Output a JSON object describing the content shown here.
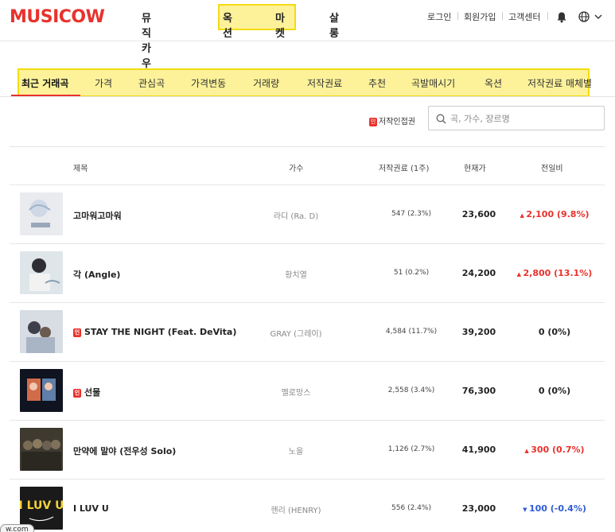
{
  "header": {
    "logo": "MUSICOW",
    "nav": [
      "뮤직카우란",
      "옥션",
      "마켓",
      "살롱"
    ],
    "util": [
      "로그인",
      "회원가입",
      "고객센터"
    ],
    "icons": [
      "bell-icon",
      "globe-icon",
      "chevron-down-icon"
    ]
  },
  "tabs": {
    "items": [
      "최근 거래곡",
      "가격",
      "관심곡",
      "가격변동",
      "거래량",
      "저작권료",
      "추천",
      "곡발매시기",
      "옥션",
      "저작권료 매체별"
    ],
    "active_index": 0
  },
  "filter": {
    "badge": "인",
    "label": "저작인접권"
  },
  "search": {
    "placeholder": "곡, 가수, 장르명",
    "value": ""
  },
  "table": {
    "headers": [
      "제목",
      "가수",
      "저작권료 (1주)",
      "현재가",
      "전일비"
    ],
    "rows": [
      {
        "title": "고마워고마워",
        "artist": "라디 (Ra. D)",
        "royalty": "547 (2.3%)",
        "price": "23,600",
        "change": "2,100 (9.8%)",
        "dir": "up",
        "neighbor": false
      },
      {
        "title": "각 (Angle)",
        "artist": "황치열",
        "royalty": "51 (0.2%)",
        "price": "24,200",
        "change": "2,800 (13.1%)",
        "dir": "up",
        "neighbor": false
      },
      {
        "title": "STAY THE NIGHT (Feat. DeVita)",
        "artist": "GRAY (그레이)",
        "royalty": "4,584 (11.7%)",
        "price": "39,200",
        "change": "0 (0%)",
        "dir": "flat",
        "neighbor": true
      },
      {
        "title": "선물",
        "artist": "멜로망스",
        "royalty": "2,558 (3.4%)",
        "price": "76,300",
        "change": "0 (0%)",
        "dir": "flat",
        "neighbor": true
      },
      {
        "title": "만약에 말야 (전우성 Solo)",
        "artist": "노을",
        "royalty": "1,126 (2.7%)",
        "price": "41,900",
        "change": "300 (0.7%)",
        "dir": "up",
        "neighbor": false
      },
      {
        "title": "I LUV U",
        "artist": "헨리 (HENRY)",
        "royalty": "556 (2.4%)",
        "price": "23,000",
        "change": "100 (-0.4%)",
        "dir": "down",
        "neighbor": false
      }
    ]
  },
  "footer": {
    "url_fragment": "w.com"
  },
  "colors": {
    "brand": "#e8322c",
    "highlight": "#fdf29a",
    "up": "#e8322c",
    "down": "#2f5bd6"
  }
}
